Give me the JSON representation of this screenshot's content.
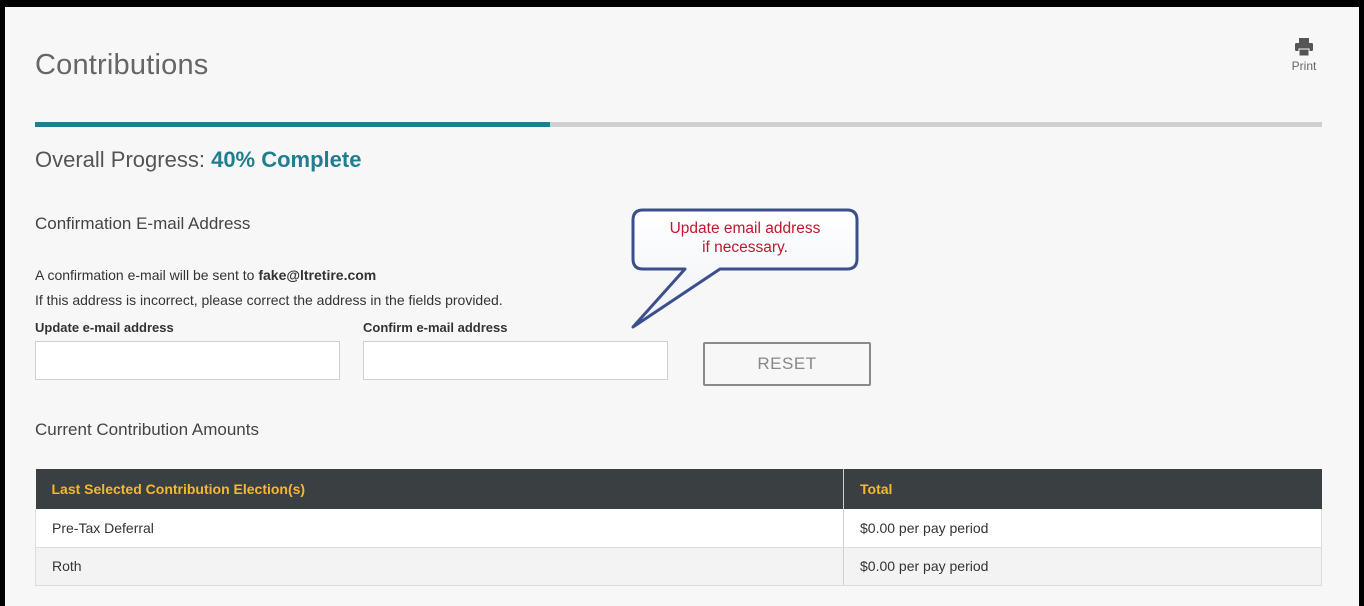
{
  "page": {
    "title": "Contributions",
    "print_label": "Print"
  },
  "progress": {
    "label": "Overall Progress:",
    "percent_text": "40% Complete",
    "value": 0.4,
    "accent_color": "#1f7e8f"
  },
  "confirmation": {
    "heading": "Confirmation E-mail Address",
    "sent_prefix": "A confirmation e-mail will be sent to",
    "email": "fake@ltretire.com",
    "instruction": "If this address is incorrect, please correct the address in the fields provided.",
    "update_label": "Update e-mail address",
    "update_value": "",
    "confirm_label": "Confirm e-mail address",
    "confirm_value": "",
    "reset_label": "RESET"
  },
  "callout": {
    "line1": "Update email address",
    "line2": "if necessary.",
    "text_color": "#c0182c"
  },
  "contributions": {
    "heading": "Current Contribution Amounts",
    "columns": [
      "Last Selected Contribution Election(s)",
      "Total"
    ],
    "rows": [
      {
        "election": "Pre-Tax Deferral",
        "total": "$0.00 per pay period"
      },
      {
        "election": "Roth",
        "total": "$0.00 per pay period"
      }
    ],
    "header_bg": "#3a3f41",
    "header_text_color": "#f5b82e"
  },
  "icons": {
    "print": "printer-icon"
  }
}
